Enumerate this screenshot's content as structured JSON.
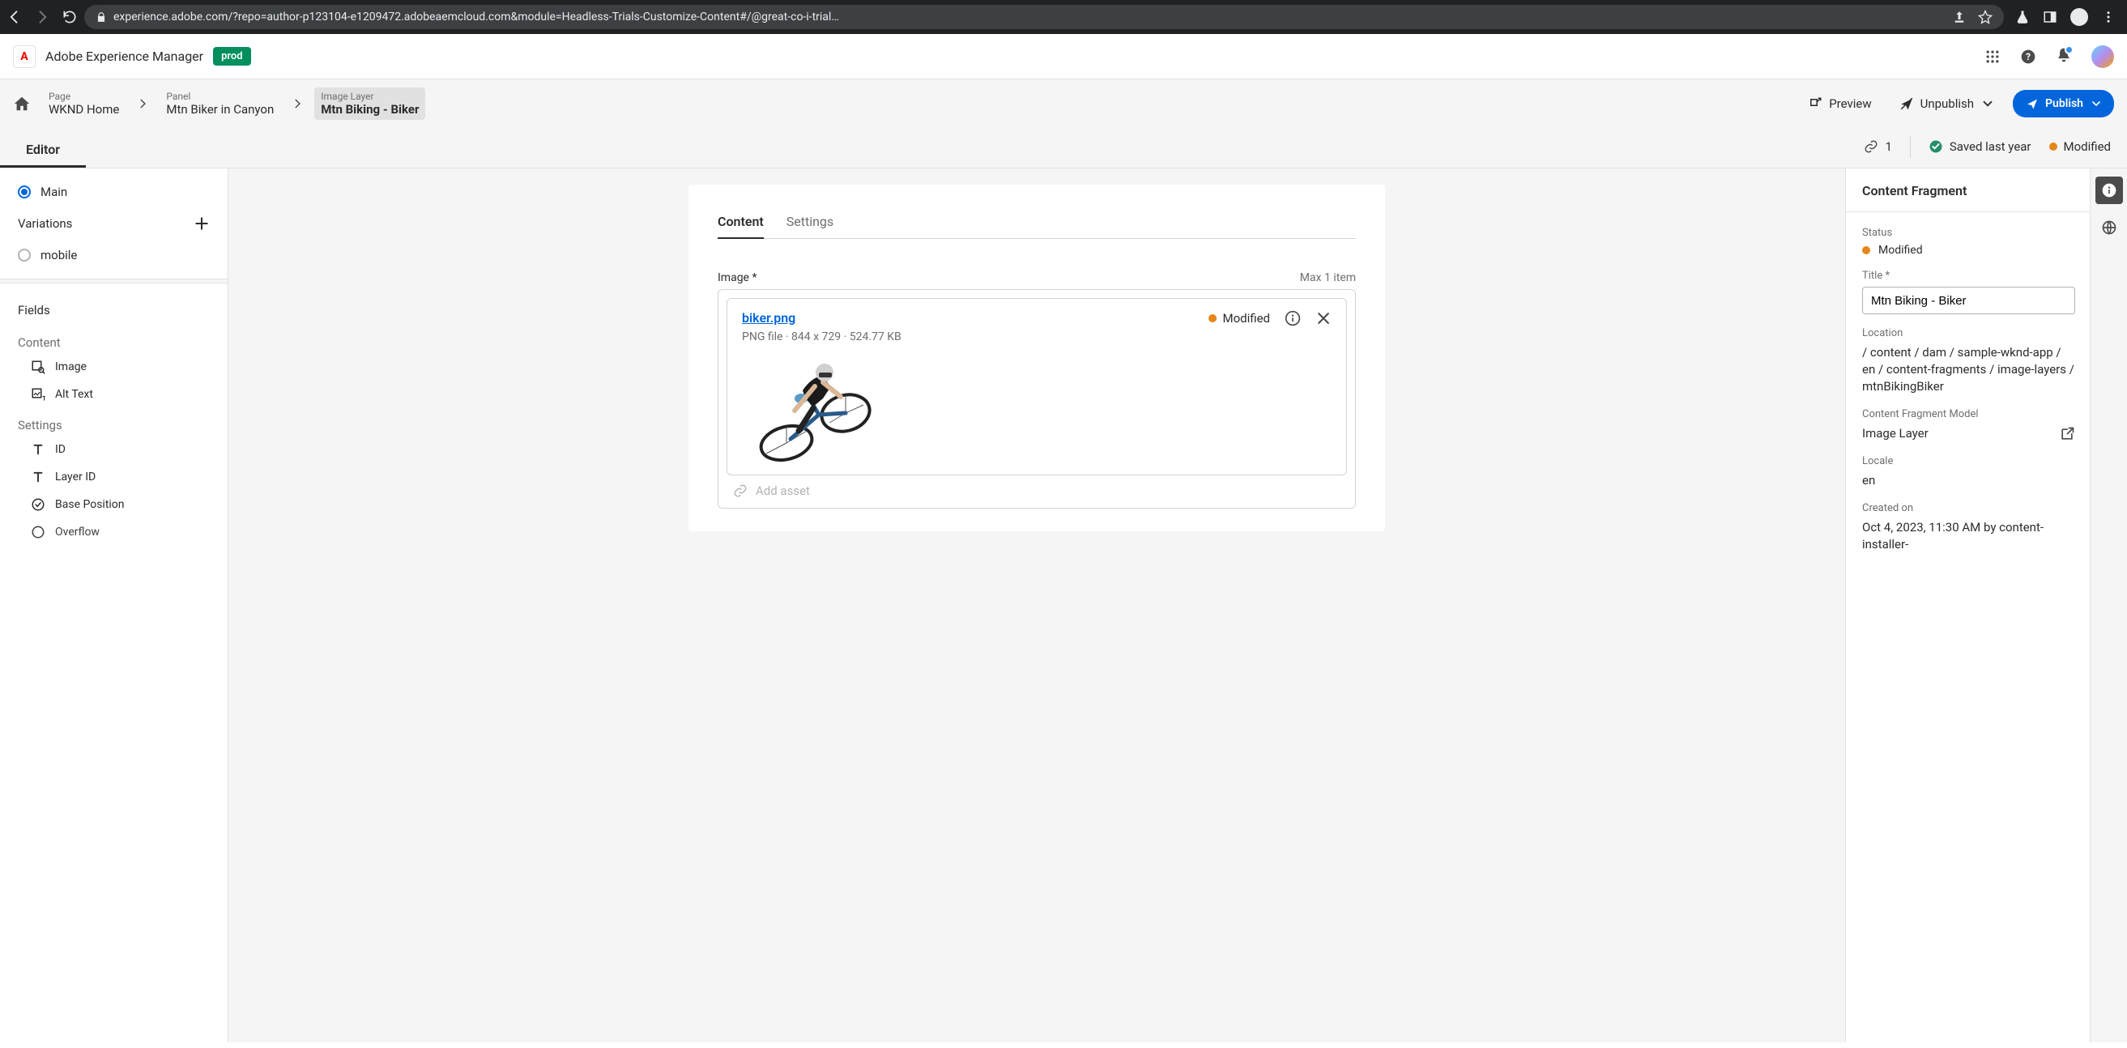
{
  "browser": {
    "url": "experience.adobe.com/?repo=author-p123104-e1209472.adobeaemcloud.com&module=Headless-Trials-Customize-Content#/@great-co-i-trial…"
  },
  "aem": {
    "product": "Adobe Experience Manager",
    "env": "prod"
  },
  "breadcrumb": {
    "items": [
      {
        "type": "Page",
        "title": "WKND Home"
      },
      {
        "type": "Panel",
        "title": "Mtn Biker in Canyon"
      },
      {
        "type": "Image Layer",
        "title": "Mtn Biking - Biker"
      }
    ]
  },
  "actions": {
    "preview": "Preview",
    "unpublish": "Unpublish",
    "publish": "Publish"
  },
  "editorTab": "Editor",
  "status": {
    "refs": "1",
    "saved": "Saved last year",
    "modified": "Modified"
  },
  "sidebar": {
    "main": "Main",
    "variationsHeader": "Variations",
    "variations": [
      {
        "label": "mobile"
      }
    ],
    "fieldsHeader": "Fields",
    "contentHeader": "Content",
    "contentFields": [
      {
        "label": "Image",
        "icon": "image-search-icon"
      },
      {
        "label": "Alt Text",
        "icon": "image-text-icon"
      }
    ],
    "settingsHeader": "Settings",
    "settingsFields": [
      {
        "label": "ID",
        "icon": "text-icon"
      },
      {
        "label": "Layer ID",
        "icon": "text-icon"
      },
      {
        "label": "Base Position",
        "icon": "check-circle-icon"
      },
      {
        "label": "Overflow",
        "icon": ""
      }
    ]
  },
  "editor": {
    "tabs": {
      "content": "Content",
      "settings": "Settings"
    },
    "imageField": {
      "label": "Image",
      "maxItems": "Max 1 item",
      "filename": "biker.png",
      "meta": "PNG file · 844 x 729 · 524.77 KB",
      "status": "Modified",
      "addAsset": "Add asset"
    }
  },
  "rail": {
    "header": "Content Fragment",
    "statusLabel": "Status",
    "status": "Modified",
    "titleLabel": "Title",
    "title": "Mtn Biking - Biker",
    "locationLabel": "Location",
    "location": "/ content / dam / sample-wknd-app / en / content-fragments / image-layers / mtnBikingBiker",
    "modelLabel": "Content Fragment Model",
    "model": "Image Layer",
    "localeLabel": "Locale",
    "locale": "en",
    "createdLabel": "Created on",
    "created": "Oct 4, 2023, 11:30 AM by content-installer-"
  }
}
